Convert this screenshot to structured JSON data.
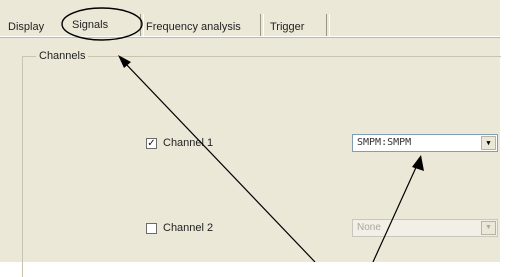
{
  "tabs": [
    {
      "label": "Display"
    },
    {
      "label": "Signals"
    },
    {
      "label": "Frequency analysis"
    },
    {
      "label": "Trigger"
    }
  ],
  "group": {
    "title": "Channels"
  },
  "channels": [
    {
      "label": "Channel 1",
      "checked": true,
      "value": "SMPM:SMPM"
    },
    {
      "label": "Channel 2",
      "checked": false,
      "value": "None"
    }
  ],
  "colors": {
    "panel": "#ece8d8",
    "annotation": "#000000"
  }
}
